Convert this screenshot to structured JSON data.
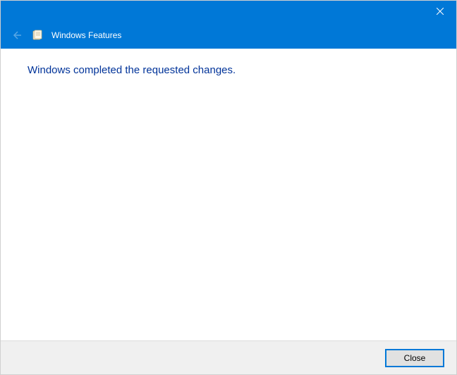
{
  "titlebar": {
    "close_tooltip": "Close"
  },
  "header": {
    "title": "Windows Features"
  },
  "content": {
    "message": "Windows completed the requested changes."
  },
  "footer": {
    "close_label": "Close"
  }
}
